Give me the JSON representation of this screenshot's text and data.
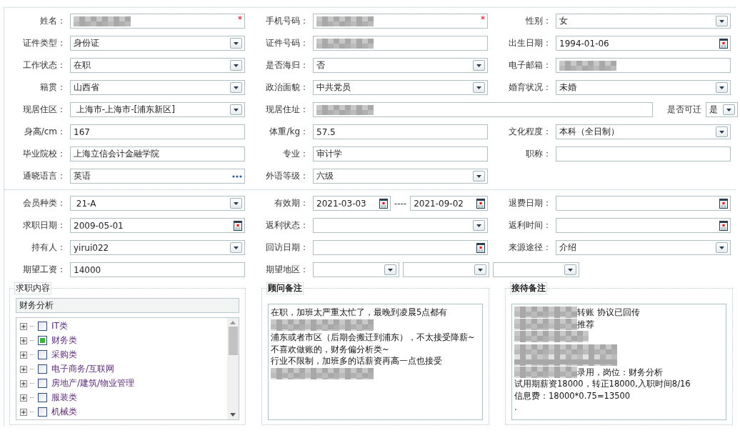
{
  "basic_info": [
    {
      "cells": [
        {
          "label": "姓名：",
          "controls": [
            {
              "kind": "text",
              "redacted": true,
              "required_mark": "*"
            }
          ]
        },
        {
          "label": "手机号码：",
          "controls": [
            {
              "kind": "text",
              "redacted": true,
              "required_mark": "*"
            }
          ]
        },
        {
          "label": "性别：",
          "controls": [
            {
              "kind": "select",
              "value": "女"
            }
          ]
        }
      ]
    },
    {
      "cells": [
        {
          "label": "证件类型：",
          "controls": [
            {
              "kind": "select",
              "value": "身份证"
            }
          ]
        },
        {
          "label": "证件号码：",
          "controls": [
            {
              "kind": "text",
              "redacted": true
            }
          ]
        },
        {
          "label": "出生日期：",
          "controls": [
            {
              "kind": "date",
              "value": "1994-01-06"
            }
          ]
        }
      ]
    },
    {
      "cells": [
        {
          "label": "工作状态：",
          "controls": [
            {
              "kind": "select",
              "value": "在职"
            }
          ]
        },
        {
          "label": "是否海归：",
          "controls": [
            {
              "kind": "select",
              "value": "否"
            }
          ]
        },
        {
          "label": "电子邮箱：",
          "controls": [
            {
              "kind": "text",
              "redacted": true
            }
          ]
        }
      ]
    },
    {
      "cells": [
        {
          "label": "籍贯：",
          "controls": [
            {
              "kind": "select",
              "value": "山西省"
            }
          ]
        },
        {
          "label": "政治面貌：",
          "controls": [
            {
              "kind": "select",
              "value": "中共党员"
            }
          ]
        },
        {
          "label": "婚育状况：",
          "controls": [
            {
              "kind": "select",
              "value": "未婚"
            }
          ]
        }
      ]
    },
    {
      "kind": "wide",
      "cells": [
        {
          "label": "现居住区：",
          "controls": [
            {
              "kind": "select",
              "value": " 上海市-上海市-[浦东新区]"
            }
          ]
        },
        {
          "label": "现居住址：",
          "controls": [
            {
              "kind": "text",
              "redacted": true
            }
          ]
        },
        {
          "label": "是否可迁",
          "controls": [
            {
              "kind": "select",
              "value": "是"
            }
          ]
        }
      ]
    },
    {
      "cells": [
        {
          "label": "身高/cm：",
          "controls": [
            {
              "kind": "text",
              "value": "167"
            }
          ]
        },
        {
          "label": "体重/kg：",
          "controls": [
            {
              "kind": "text",
              "value": "57.5"
            }
          ]
        },
        {
          "label": "文化程度：",
          "controls": [
            {
              "kind": "select",
              "value": "本科（全日制）"
            }
          ]
        }
      ]
    },
    {
      "cells": [
        {
          "label": "毕业院校：",
          "controls": [
            {
              "kind": "text",
              "value": "上海立信会计金融学院"
            }
          ]
        },
        {
          "label": "专业：",
          "controls": [
            {
              "kind": "text",
              "value": "审计学"
            }
          ]
        },
        {
          "label": "职称：",
          "controls": [
            {
              "kind": "text"
            }
          ]
        }
      ]
    },
    {
      "cells": [
        {
          "label": "通晓语言：",
          "controls": [
            {
              "kind": "lookup",
              "value": "英语"
            }
          ]
        },
        {
          "label": "外语等级：",
          "controls": [
            {
              "kind": "select",
              "value": "六级"
            }
          ]
        }
      ]
    }
  ],
  "membership": [
    {
      "cells": [
        {
          "label": "会员种类：",
          "controls": [
            {
              "kind": "select",
              "value": " 21-A"
            }
          ]
        },
        {
          "label": "有效期：",
          "separator": "----",
          "controls": [
            {
              "kind": "date",
              "value": "2021-03-03"
            },
            {
              "kind": "date",
              "value": "2021-09-02"
            }
          ]
        },
        {
          "label": "退费日期：",
          "controls": [
            {
              "kind": "date"
            }
          ]
        }
      ]
    },
    {
      "cells": [
        {
          "label": "求职日期：",
          "controls": [
            {
              "kind": "date",
              "value": "2009-05-01"
            }
          ]
        },
        {
          "label": "返利状态：",
          "controls": [
            {
              "kind": "select"
            }
          ]
        },
        {
          "label": "返利时间：",
          "controls": [
            {
              "kind": "date"
            }
          ]
        }
      ]
    },
    {
      "cells": [
        {
          "label": "持有人：",
          "controls": [
            {
              "kind": "select",
              "value": "yirui022"
            }
          ]
        },
        {
          "label": "回访日期：",
          "controls": [
            {
              "kind": "date"
            }
          ]
        },
        {
          "label": "来源途径：",
          "controls": [
            {
              "kind": "select",
              "value": "介绍"
            }
          ]
        }
      ]
    },
    {
      "cells": [
        {
          "label": "期望工资：",
          "controls": [
            {
              "kind": "text",
              "value": "14000"
            }
          ]
        },
        {
          "label": "期望地区：",
          "controls": [
            {
              "kind": "select"
            },
            {
              "kind": "select"
            },
            {
              "kind": "select"
            }
          ]
        }
      ]
    }
  ],
  "panels": [
    {
      "kind": "tree",
      "legend": "求职内容",
      "value": "财务分析",
      "items": [
        {
          "label": "IT类",
          "checked": false,
          "expanded": false
        },
        {
          "label": "财务类",
          "checked": true,
          "expanded": false
        },
        {
          "label": "采购类",
          "checked": false,
          "expanded": false
        },
        {
          "label": "电子商务/互联网",
          "checked": false,
          "expanded": false
        },
        {
          "label": "房地产/建筑/物业管理",
          "checked": false,
          "expanded": false
        },
        {
          "label": "服装类",
          "checked": false,
          "expanded": false
        },
        {
          "label": "机械类",
          "checked": false,
          "expanded": false
        }
      ]
    },
    {
      "kind": "notes",
      "legend": "顾问备注",
      "lines": [
        {
          "kind": "text",
          "text": "在职，加班太严重太忙了，最晚到凌晨5点都有"
        },
        {
          "kind": "blurred"
        },
        {
          "kind": "text",
          "text": "浦东或者市区（后期会搬迁到浦东），不太接受降薪~"
        },
        {
          "kind": "text",
          "text": "不喜欢做账的，财务偏分析类~"
        },
        {
          "kind": "text",
          "text": "行业不限制，加班多的话薪资再高一点也接受"
        },
        {
          "kind": "blurred"
        }
      ]
    },
    {
      "kind": "notes",
      "legend": "接待备注",
      "lines": [
        {
          "kind": "blurred-lead",
          "text": "转账  协议已回传"
        },
        {
          "kind": "blurred-lead",
          "text": "推荐"
        },
        {
          "kind": "blurred"
        },
        {
          "kind": "blurred"
        },
        {
          "kind": "blurred-lead",
          "text": "录用，岗位：财务分析"
        },
        {
          "kind": "text",
          "text": "试用期薪资18000，转正18000,入职时间8/16"
        },
        {
          "kind": "text",
          "text": "信息费：18000*0.75=13500"
        },
        {
          "kind": "text",
          "text": "."
        }
      ]
    }
  ]
}
